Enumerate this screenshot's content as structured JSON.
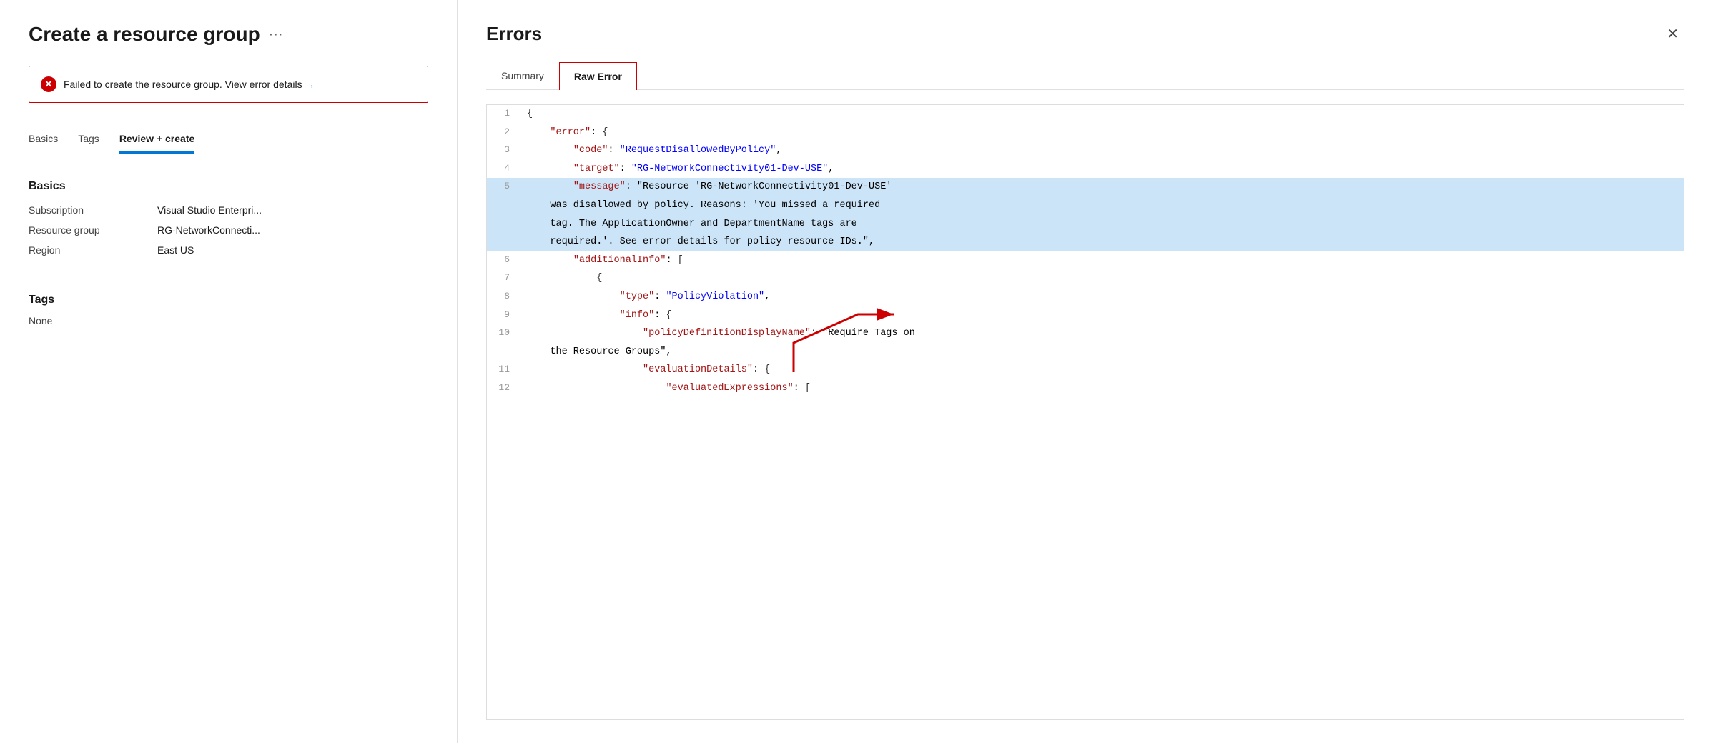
{
  "left": {
    "title": "Create a resource group",
    "ellipsis": "···",
    "error_banner": {
      "text": "Failed to create the resource group. View error details",
      "arrow": "→"
    },
    "tabs": [
      {
        "label": "Basics",
        "active": false
      },
      {
        "label": "Tags",
        "active": false
      },
      {
        "label": "Review + create",
        "active": true
      }
    ],
    "basics_section": "Basics",
    "fields": [
      {
        "label": "Subscription",
        "value": "Visual Studio Enterpri..."
      },
      {
        "label": "Resource group",
        "value": "RG-NetworkConnecti..."
      },
      {
        "label": "Region",
        "value": "East US"
      }
    ],
    "tags_section": "Tags",
    "tags_value": "None"
  },
  "right": {
    "title": "Errors",
    "close_label": "✕",
    "sub_tabs": [
      {
        "label": "Summary",
        "active": false
      },
      {
        "label": "Raw Error",
        "active": true
      }
    ],
    "code_lines": [
      {
        "number": 1,
        "content": "{",
        "highlighted": false
      },
      {
        "number": 2,
        "content": "    \"error\": {",
        "highlighted": false
      },
      {
        "number": 3,
        "content": "        \"code\": \"RequestDisallowedByPolicy\",",
        "highlighted": false
      },
      {
        "number": 4,
        "content": "        \"target\": \"RG-NetworkConnectivity01-Dev-USE\",",
        "highlighted": false
      },
      {
        "number": 5,
        "content": "        \"message\": \"Resource 'RG-NetworkConnectivity01-Dev-USE'",
        "highlighted": true
      },
      {
        "number": "",
        "content": "    was disallowed by policy. Reasons: 'You missed a required",
        "highlighted": true
      },
      {
        "number": "",
        "content": "    tag. The ApplicationOwner and DepartmentName tags are",
        "highlighted": true
      },
      {
        "number": "",
        "content": "    required.'. See error details for policy resource IDs.\",",
        "highlighted": true
      },
      {
        "number": 6,
        "content": "        \"additionalInfo\": [",
        "highlighted": false
      },
      {
        "number": 7,
        "content": "            {",
        "highlighted": false
      },
      {
        "number": 8,
        "content": "                \"type\": \"PolicyViolation\",",
        "highlighted": false
      },
      {
        "number": 9,
        "content": "                \"info\": {",
        "highlighted": false
      },
      {
        "number": 10,
        "content": "                    \"policyDefinitionDisplayName\": \"Require Tags on",
        "highlighted": false
      },
      {
        "number": "",
        "content": "    the Resource Groups\",",
        "highlighted": false
      },
      {
        "number": 11,
        "content": "                    \"evaluationDetails\": {",
        "highlighted": false
      },
      {
        "number": 12,
        "content": "                        \"evaluatedExpressions\": [",
        "highlighted": false
      }
    ]
  }
}
